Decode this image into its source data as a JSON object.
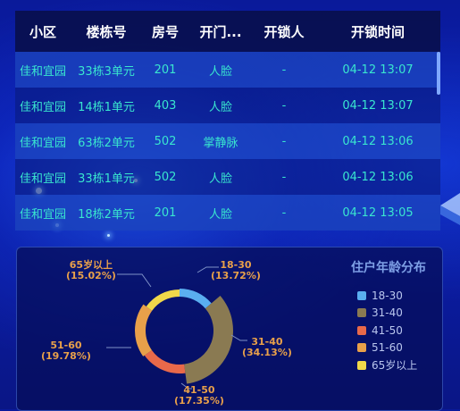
{
  "table": {
    "headers": [
      "小区",
      "楼栋号",
      "房号",
      "开门...",
      "开锁人",
      "开锁时间"
    ],
    "rows": [
      [
        "佳和宜园",
        "33栋3单元",
        "201",
        "人脸",
        "-",
        "04-12 13:07"
      ],
      [
        "佳和宜园",
        "14栋1单元",
        "403",
        "人脸",
        "-",
        "04-12 13:07"
      ],
      [
        "佳和宜园",
        "63栋2单元",
        "502",
        "掌静脉",
        "-",
        "04-12 13:06"
      ],
      [
        "佳和宜园",
        "33栋1单元",
        "502",
        "人脸",
        "-",
        "04-12 13:06"
      ],
      [
        "佳和宜园",
        "18栋2单元",
        "201",
        "人脸",
        "-",
        "04-12 13:05"
      ]
    ]
  },
  "chart_data": {
    "type": "pie",
    "title": "住户年龄分布",
    "categories": [
      "18-30",
      "31-40",
      "41-50",
      "51-60",
      "65岁以上"
    ],
    "values": [
      13.72,
      34.13,
      17.35,
      19.78,
      15.02
    ],
    "value_labels": [
      "(13.72%)",
      "(34.13%)",
      "(17.35%)",
      "(19.78%)",
      "(15.02%)"
    ],
    "colors": [
      "#5aaef0",
      "#8a7a52",
      "#e8694a",
      "#e8a04a",
      "#f0d84a"
    ],
    "legend_position": "right"
  }
}
